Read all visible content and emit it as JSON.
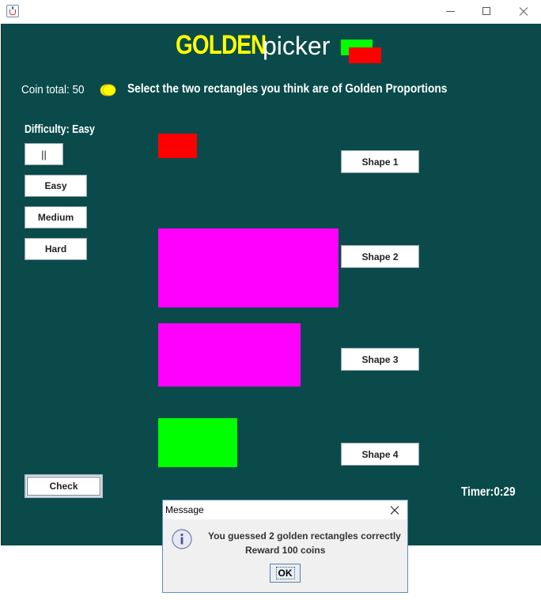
{
  "window": {
    "icon": "java-cup-icon"
  },
  "header": {
    "logo_golden": "GOLDEN",
    "logo_picker": "picker"
  },
  "status": {
    "coin_total": "Coin total: 50",
    "instruction": "Select the two rectangles you think are of Golden Proportions",
    "difficulty": "Difficulty: Easy",
    "timer": "Timer:0:29"
  },
  "controls": {
    "pause_label": "||",
    "easy_label": "Easy",
    "medium_label": "Medium",
    "hard_label": "Hard",
    "check_label": "Check"
  },
  "shapes": [
    {
      "label": "Shape 1",
      "color": "#ff0000"
    },
    {
      "label": "Shape 2",
      "color": "#ff00ff"
    },
    {
      "label": "Shape 3",
      "color": "#ff00ff"
    },
    {
      "label": "Shape 4",
      "color": "#00ff00"
    }
  ],
  "colors": {
    "background": "#0a4a4a",
    "logo_yellow": "#ffff00",
    "logo_green": "#00ff00",
    "logo_red": "#ff0000"
  },
  "dialog": {
    "title": "Message",
    "icon": "info-icon",
    "line1": "You guessed 2 golden rectangles correctly",
    "line2": "Reward 100 coins",
    "ok_label": "OK"
  }
}
